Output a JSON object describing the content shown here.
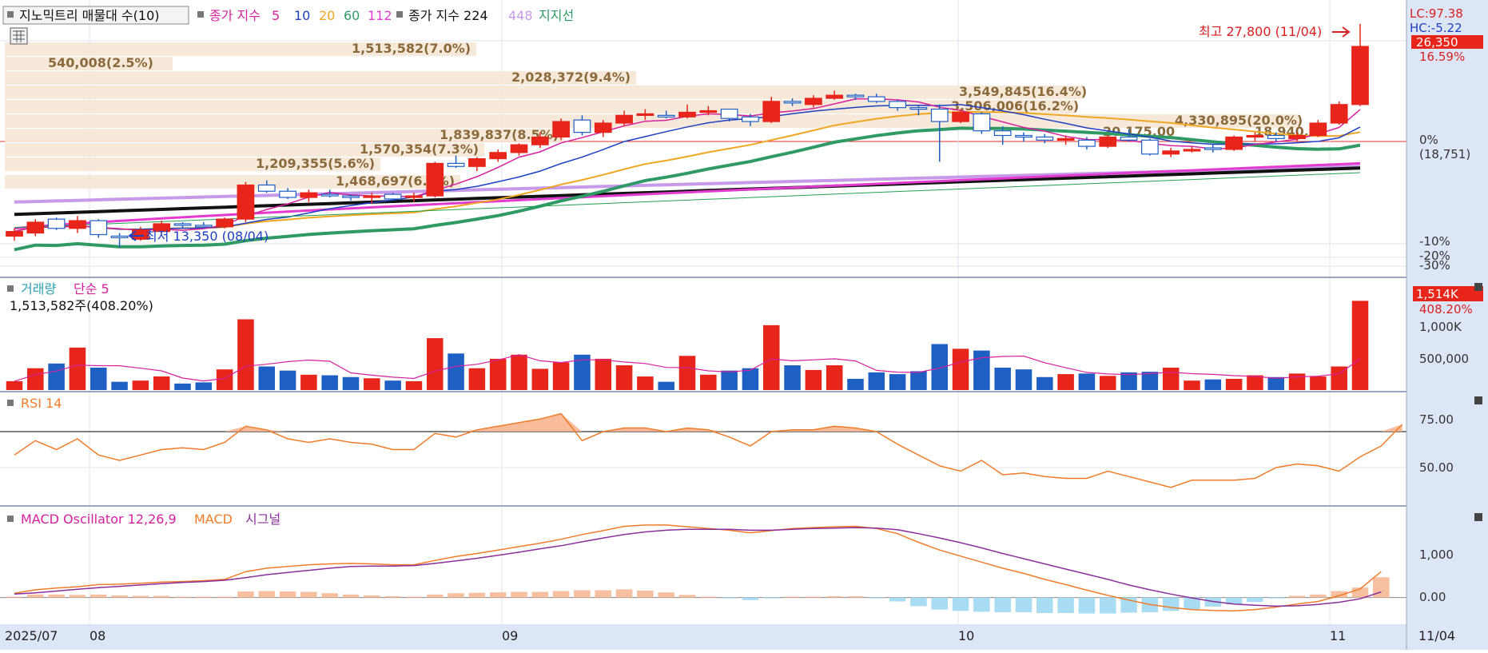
{
  "legend": {
    "indicator_box": "지노믹트리 매물대 수(10)",
    "ma_label": "종가 지수",
    "ma5": "5",
    "ma10": "10",
    "ma20": "20",
    "ma60": "60",
    "ma112": "112",
    "ma224_label": "종가 지수 224",
    "ma448": "448",
    "support": "지지선"
  },
  "right_axis": {
    "lc": "LC:97.38",
    "hc": "HC:-5.22",
    "price": "26,350",
    "pct": "16.59%",
    "zero": "0%",
    "zero_val": "(18,751)",
    "m10": "-10%",
    "m20": "-20%",
    "m30": "-30%"
  },
  "high_note": "최고 27,800 (11/04)",
  "low_note": "최저 13,350 (08/04)",
  "volume_profile": [
    {
      "label": "1,513,582(7.0%)",
      "row": 0
    },
    {
      "label": "540,008(2.5%)",
      "row": 1
    },
    {
      "label": "2,028,372(9.4%)",
      "row": 2
    },
    {
      "label": "3,549,845(16.4%)",
      "row": 3
    },
    {
      "label": "3,506,006(16.2%)",
      "row": 4
    },
    {
      "label": "4,330,895(20.0%)",
      "row": 5
    },
    {
      "label": "1,839,837(8.5%)",
      "row": 6
    },
    {
      "label": "1,570,354(7.3%)",
      "row": 7
    },
    {
      "label": "1,209,355(5.6%)",
      "row": 8
    },
    {
      "label": "1,468,697(6.8%)",
      "row": 9
    }
  ],
  "pct_label": "20.175.00",
  "support_label": "18,940.00",
  "volume": {
    "title": "거래량",
    "ma": "단순 5",
    "subtitle": "1,513,582주(408.20%)",
    "badge": "1,514K",
    "badge_pct": "408.20%",
    "tick1": "1,000K",
    "tick2": "500,000"
  },
  "rsi": {
    "title": "RSI 14",
    "tick1": "75.00",
    "tick2": "50.00"
  },
  "macd": {
    "title": "MACD Oscillator 12,26,9",
    "macd": "MACD",
    "signal": "시그널",
    "tick1": "1,000",
    "tick2": "0.00"
  },
  "x_axis": {
    "start": "2025/07",
    "m08": "08",
    "m09": "09",
    "m10": "10",
    "m11": "11",
    "right": "11/04"
  },
  "colors": {
    "up": "#e8251a",
    "down": "#1e5fc4",
    "ma5": "#d6219e",
    "ma10": "#1d3fc2",
    "ma20": "#f0a620",
    "ma60": "#2f9a66",
    "ma112": "#e33bd0",
    "ma224": "#111111",
    "ma448": "#c69ae8",
    "rsi": "#f07c2a",
    "macd": "#f07c2a",
    "signal": "#8b2f9b",
    "osc_pos": "#f6bfa0",
    "osc_neg": "#a8dcf2"
  },
  "chart_data": {
    "type": "candlestick",
    "title": "지노믹트리 매물대 수(10)",
    "dates_start": "2025/07",
    "dates_end": "11/04",
    "ohlc": [
      [
        14100,
        14600,
        13800,
        14400
      ],
      [
        14300,
        15200,
        14100,
        15000
      ],
      [
        15200,
        15300,
        14500,
        14600
      ],
      [
        14600,
        15400,
        14300,
        15100
      ],
      [
        15100,
        15200,
        14000,
        14200
      ],
      [
        14100,
        14300,
        13350,
        14000
      ],
      [
        13900,
        14700,
        13800,
        14500
      ],
      [
        14400,
        15100,
        14300,
        14900
      ],
      [
        14900,
        15000,
        14600,
        14800
      ],
      [
        14800,
        15000,
        14600,
        14700
      ],
      [
        14700,
        15300,
        14600,
        15200
      ],
      [
        15200,
        17600,
        15000,
        17400
      ],
      [
        17400,
        17700,
        16900,
        17000
      ],
      [
        17000,
        17200,
        16500,
        16600
      ],
      [
        16600,
        17100,
        16300,
        16900
      ],
      [
        16800,
        17100,
        16600,
        16700
      ],
      [
        16700,
        16800,
        16400,
        16600
      ],
      [
        16600,
        16900,
        16200,
        16700
      ],
      [
        16800,
        16900,
        16400,
        16500
      ],
      [
        16600,
        16900,
        16300,
        16700
      ],
      [
        16700,
        18900,
        16600,
        18800
      ],
      [
        18800,
        19300,
        18500,
        18600
      ],
      [
        18600,
        19200,
        18300,
        19100
      ],
      [
        19100,
        19700,
        18900,
        19500
      ],
      [
        19500,
        20100,
        19300,
        20000
      ],
      [
        20000,
        20800,
        19800,
        20500
      ],
      [
        20500,
        21700,
        20300,
        21500
      ],
      [
        21600,
        21900,
        20600,
        20800
      ],
      [
        20800,
        21600,
        20500,
        21400
      ],
      [
        21400,
        22200,
        21200,
        21900
      ],
      [
        21900,
        22300,
        21600,
        22000
      ],
      [
        21900,
        22200,
        21700,
        21800
      ],
      [
        21800,
        22600,
        21700,
        22100
      ],
      [
        22100,
        22500,
        21900,
        22200
      ],
      [
        22300,
        22300,
        21500,
        21700
      ],
      [
        21800,
        22000,
        21200,
        21500
      ],
      [
        21500,
        23100,
        21400,
        22800
      ],
      [
        22800,
        23000,
        22500,
        22700
      ],
      [
        22600,
        23200,
        22400,
        23000
      ],
      [
        23000,
        23500,
        22900,
        23200
      ],
      [
        23200,
        23300,
        22900,
        23100
      ],
      [
        23100,
        23300,
        22700,
        22800
      ],
      [
        22800,
        22900,
        22200,
        22400
      ],
      [
        22400,
        22500,
        21900,
        22300
      ],
      [
        22300,
        22600,
        18900,
        21500
      ],
      [
        21500,
        22300,
        21400,
        22100
      ],
      [
        22000,
        22100,
        20700,
        20900
      ],
      [
        20900,
        21200,
        20000,
        20600
      ],
      [
        20600,
        20800,
        20200,
        20500
      ],
      [
        20500,
        20700,
        20100,
        20300
      ],
      [
        20300,
        20600,
        20000,
        20400
      ],
      [
        20300,
        20500,
        19700,
        19900
      ],
      [
        19900,
        20600,
        19800,
        20500
      ],
      [
        20500,
        21000,
        20200,
        20300
      ],
      [
        20300,
        20400,
        19300,
        19400
      ],
      [
        19400,
        19800,
        19200,
        19600
      ],
      [
        19600,
        19900,
        19500,
        19700
      ],
      [
        19800,
        20000,
        19500,
        19700
      ],
      [
        19700,
        20600,
        19600,
        20500
      ],
      [
        20500,
        20800,
        20200,
        20600
      ],
      [
        20600,
        20800,
        20200,
        20400
      ],
      [
        20400,
        20800,
        20200,
        20600
      ],
      [
        20600,
        21600,
        20500,
        21400
      ],
      [
        21400,
        22800,
        21300,
        22600
      ],
      [
        22600,
        27800,
        22500,
        26350
      ]
    ],
    "volume": [
      150000,
      370000,
      450000,
      720000,
      380000,
      140000,
      160000,
      230000,
      110000,
      130000,
      350000,
      1200000,
      400000,
      330000,
      260000,
      250000,
      220000,
      200000,
      160000,
      150000,
      880000,
      620000,
      370000,
      530000,
      600000,
      360000,
      470000,
      600000,
      530000,
      420000,
      230000,
      140000,
      580000,
      260000,
      330000,
      370000,
      1100000,
      420000,
      340000,
      420000,
      190000,
      300000,
      270000,
      320000,
      780000,
      700000,
      670000,
      380000,
      350000,
      220000,
      270000,
      280000,
      240000,
      300000,
      310000,
      380000,
      160000,
      180000,
      190000,
      250000,
      220000,
      280000,
      230000,
      400000,
      1513582
    ],
    "rsi": [
      57,
      65,
      60,
      66,
      57,
      54,
      57,
      60,
      61,
      60,
      64,
      73,
      71,
      66,
      64,
      66,
      64,
      63,
      60,
      60,
      69,
      67,
      71,
      73,
      75,
      77,
      80,
      65,
      70,
      72,
      72,
      70,
      72,
      71,
      67,
      62,
      70,
      71,
      71,
      73,
      72,
      70,
      63,
      57,
      51,
      48,
      54,
      46,
      47,
      45,
      44,
      44,
      48,
      45,
      42,
      39,
      43,
      43,
      43,
      44,
      50,
      52,
      51,
      48,
      56,
      62,
      74
    ],
    "macd": [
      100,
      180,
      220,
      250,
      300,
      310,
      330,
      360,
      370,
      390,
      420,
      600,
      680,
      720,
      760,
      780,
      790,
      780,
      760,
      760,
      860,
      950,
      1020,
      1100,
      1180,
      1260,
      1350,
      1460,
      1550,
      1650,
      1680,
      1680,
      1640,
      1600,
      1560,
      1500,
      1550,
      1600,
      1620,
      1640,
      1650,
      1600,
      1480,
      1280,
      1100,
      960,
      820,
      680,
      560,
      420,
      300,
      170,
      50,
      -60,
      -160,
      -230,
      -280,
      -300,
      -310,
      -280,
      -220,
      -150,
      -90,
      40,
      200,
      600
    ],
    "signal": [
      80,
      110,
      150,
      190,
      230,
      260,
      290,
      320,
      350,
      370,
      400,
      460,
      530,
      580,
      630,
      680,
      720,
      730,
      730,
      740,
      790,
      850,
      910,
      980,
      1050,
      1130,
      1200,
      1290,
      1380,
      1460,
      1520,
      1560,
      1580,
      1580,
      1580,
      1560,
      1560,
      1580,
      1600,
      1610,
      1620,
      1610,
      1570,
      1480,
      1380,
      1270,
      1150,
      1020,
      900,
      780,
      660,
      540,
      420,
      290,
      180,
      80,
      -10,
      -90,
      -150,
      -180,
      -200,
      -190,
      -160,
      -110,
      -30,
      130
    ],
    "oscillator": [
      20,
      70,
      70,
      60,
      70,
      50,
      40,
      40,
      20,
      20,
      20,
      140,
      150,
      140,
      130,
      100,
      70,
      50,
      30,
      20,
      70,
      100,
      110,
      120,
      130,
      130,
      150,
      170,
      170,
      190,
      160,
      120,
      60,
      20,
      -20,
      -60,
      -10,
      20,
      20,
      30,
      30,
      -10,
      -90,
      -200,
      -280,
      -310,
      -330,
      -340,
      -340,
      -360,
      -360,
      -370,
      -370,
      -350,
      -340,
      -310,
      -270,
      -210,
      -160,
      -100,
      -20,
      40,
      70,
      150,
      230,
      470
    ],
    "ylim_price": [
      11800,
      27800
    ],
    "ylim_volume": [
      0,
      1600000
    ],
    "ylim_rsi": [
      30,
      90
    ],
    "ylim_macd": [
      -600,
      1900
    ]
  }
}
